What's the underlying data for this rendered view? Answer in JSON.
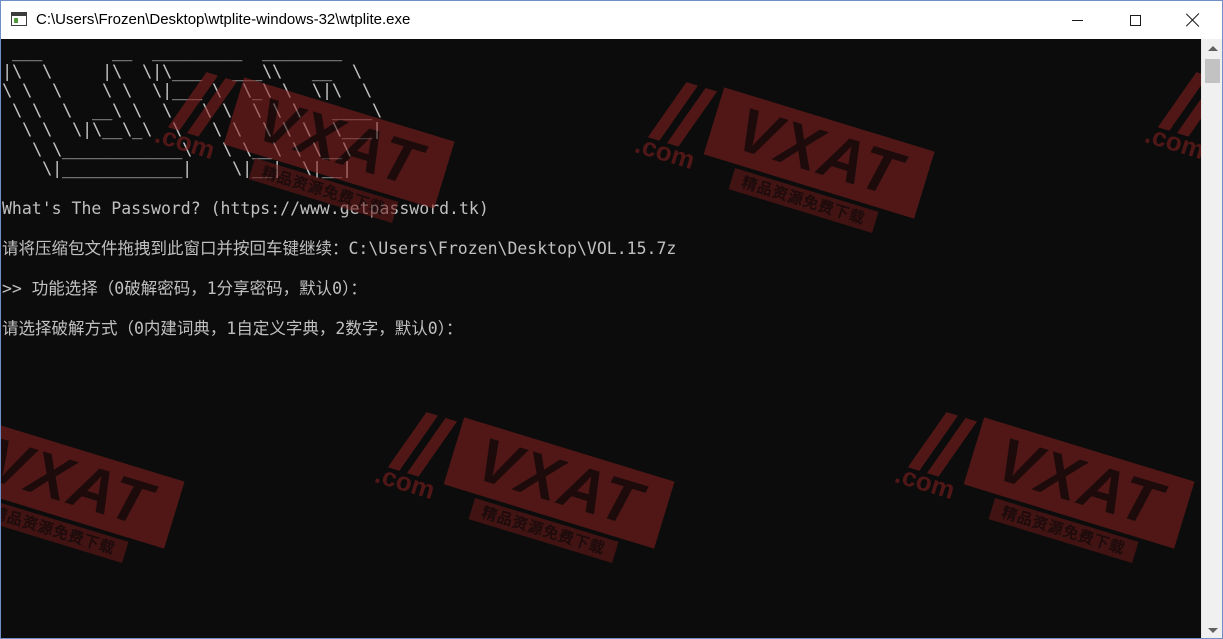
{
  "window": {
    "title": "C:\\Users\\Frozen\\Desktop\\wtplite-windows-32\\wtplite.exe",
    "icon": "console-app-icon"
  },
  "console": {
    "banner": " ___       __  _________  ________\n|\\  \\     |\\  \\|\\___   ___\\\\   __  \\\n\\ \\  \\    \\ \\  \\|___ \\  \\_\\ \\  \\|\\  \\\n \\ \\  \\  __\\ \\  \\   \\ \\  \\ \\ \\   ____\\\n  \\ \\  \\|\\__\\_\\  \\   \\ \\  \\ \\ \\  \\___|\n   \\ \\____________\\   \\ \\__\\ \\ \\__\\\n    \\|____________|    \\|__|  \\|__|",
    "lines": [
      "What's The Password? (https://www.getpassword.tk)",
      "请将压缩包文件拖拽到此窗口并按回车键继续：C:\\Users\\Frozen\\Desktop\\VOL.15.7z",
      ">> 功能选择（0破解密码，1分享密码，默认0）：",
      "请选择破解方式（0内建词典，1自定义字典，2数字，默认0）："
    ]
  },
  "watermark": {
    "brand": "VXAT",
    "domain": ".com",
    "slogan": "精品资源免费下载"
  },
  "colors": {
    "console_bg": "#0c0c0c",
    "console_text": "#c0c0c0",
    "watermark": "#8b2020",
    "titlebar_bg": "#ffffff"
  }
}
